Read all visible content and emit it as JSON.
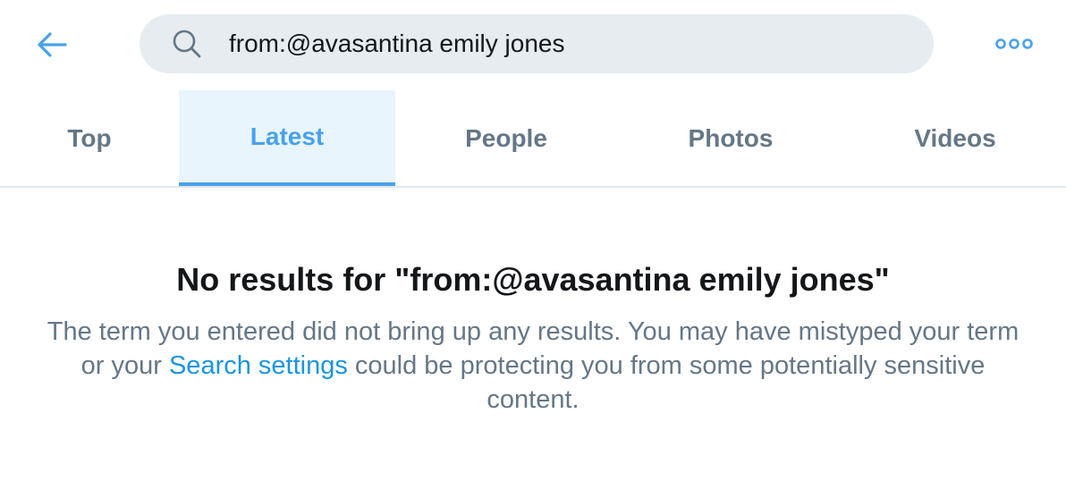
{
  "search": {
    "query": "from:@avasantina emily jones"
  },
  "tabs": [
    {
      "label": "Top",
      "active": false
    },
    {
      "label": "Latest",
      "active": true
    },
    {
      "label": "People",
      "active": false
    },
    {
      "label": "Photos",
      "active": false
    },
    {
      "label": "Videos",
      "active": false
    }
  ],
  "empty_state": {
    "title": "No results for \"from:@avasantina emily jones\"",
    "desc_before": "The term you entered did not bring up any results. You may have mistyped your term or your ",
    "link_text": "Search settings",
    "desc_after": " could be protecting you from some potentially sensitive content."
  },
  "icons": {
    "back": "arrow-left-icon",
    "search": "magnifier-icon",
    "more": "more-dots-icon"
  },
  "colors": {
    "accent": "#4aa1eb",
    "link": "#1b95e0",
    "muted_text": "#657786",
    "search_bg": "#e6ecf0",
    "active_tab_bg": "#e8f5fd"
  }
}
